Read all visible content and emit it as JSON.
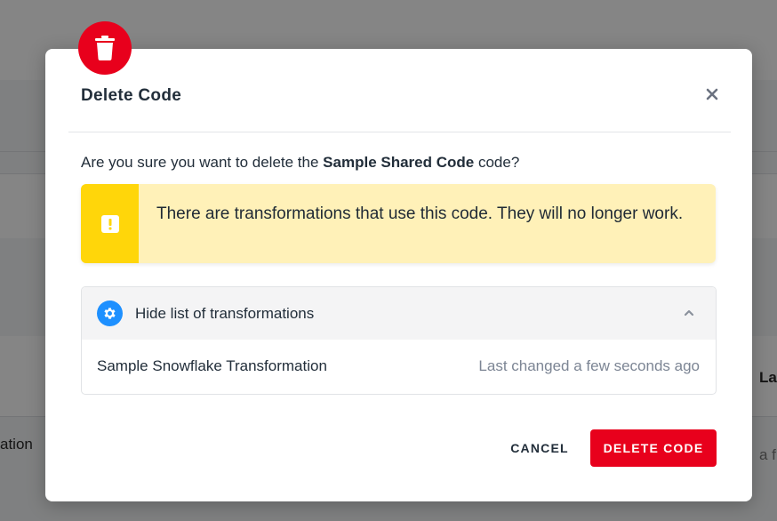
{
  "background": {
    "left_fragment": "ation",
    "right_fragment_top": "La",
    "right_fragment_bottom": "a f"
  },
  "modal": {
    "title": "Delete Code",
    "question_prefix": "Are you sure you want to delete the ",
    "code_name": "Sample Shared Code",
    "question_suffix": " code?",
    "warning_text": "There are transformations that use this code. They will no longer work.",
    "toggle_label": "Hide list of transformations",
    "transformations": [
      {
        "name": "Sample Snowflake Transformation",
        "last_changed": "Last changed a few seconds ago"
      }
    ],
    "cancel_label": "CANCEL",
    "delete_label": "DELETE CODE"
  },
  "colors": {
    "danger": "#e8001c",
    "warning_strip": "#ffd60a",
    "warning_bg": "#fff1b8",
    "accent_blue": "#1e90ff"
  },
  "icons": [
    "trash-icon",
    "close-icon",
    "warning-icon",
    "gear-icon",
    "chevron-up-icon"
  ]
}
